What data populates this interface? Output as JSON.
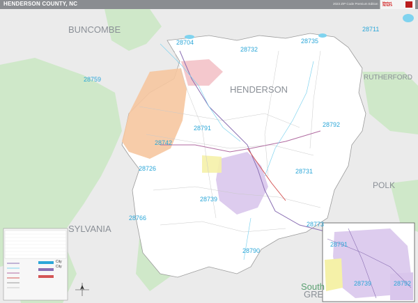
{
  "header": {
    "title": "HENDERSON COUNTY, NC",
    "edition": "2023 ZIP Code Premium Edition",
    "logo_top": "Market",
    "logo_brand": "MAPS"
  },
  "counties": {
    "buncombe": "BUNCOMBE",
    "henderson": "HENDERSON",
    "rutherford": "RUTHERFORD",
    "polk": "POLK",
    "transylvania": "SYLVANIA",
    "south_gre": "GRE",
    "south_partial": "South"
  },
  "zips": {
    "z28704": "28704",
    "z28732": "28732",
    "z28735": "28735",
    "z28711": "28711",
    "z28759": "28759",
    "z28791": "28791",
    "z28792": "28792",
    "z28742": "28742",
    "z28726": "28726",
    "z28731": "28731",
    "z28739": "28739",
    "z28766": "28766",
    "z28773": "28773",
    "z28790": "28790",
    "inset_28791": "28791",
    "inset_28739": "28739",
    "inset_28792": "28792"
  },
  "legend": {
    "city_label": "City",
    "city_label2": "City"
  },
  "colors": {
    "water": "#7fd3ef",
    "zip_label": "#2aa6d8",
    "county_label": "#8a8f96",
    "outside": "#ebebeb",
    "green": "#cfe8c9",
    "orange": "#f6c6a0",
    "pink": "#f3c2c8",
    "purple": "#d9c6ec",
    "yellow": "#f5f1a8"
  }
}
